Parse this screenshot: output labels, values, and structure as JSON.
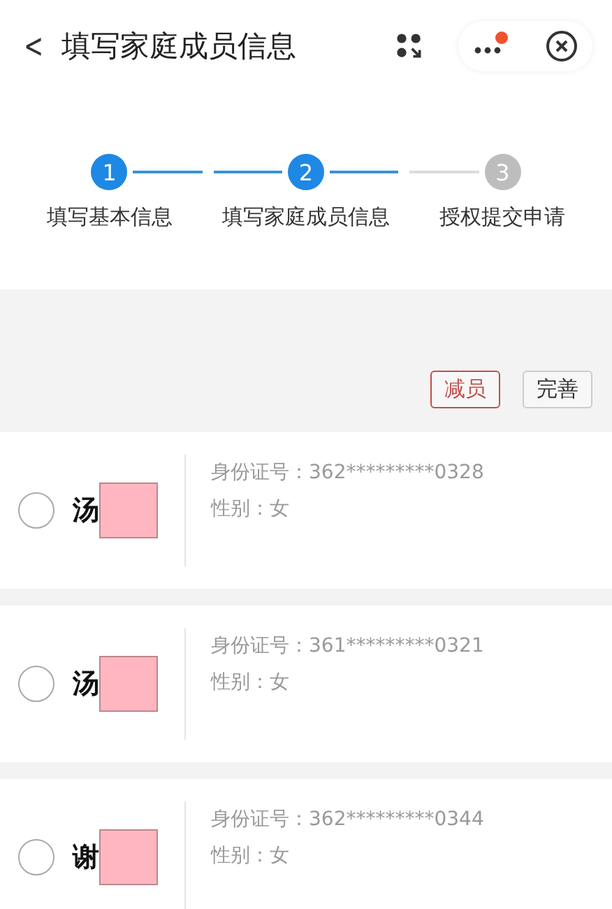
{
  "header": {
    "back": "<",
    "title": "填写家庭成员信息"
  },
  "steps": [
    {
      "number": "1",
      "label": "填写基本信息",
      "active": true
    },
    {
      "number": "2",
      "label": "填写家庭成员信息",
      "active": true
    },
    {
      "number": "3",
      "label": "授权提交申请",
      "active": false
    }
  ],
  "actions": [
    {
      "label": "减员",
      "kind": "danger"
    },
    {
      "label": "完善",
      "kind": "plain"
    }
  ],
  "members": [
    {
      "name": "汤",
      "selected": false,
      "id_label": "身份证号：",
      "id_number": "362*********0328",
      "gender_label": "性别：",
      "gender": "女"
    },
    {
      "name": "汤",
      "selected": false,
      "id_label": "身份证号：",
      "id_number": "361*********0321",
      "gender_label": "性别：",
      "gender": "女"
    },
    {
      "name": "谢",
      "selected": false,
      "id_label": "身份证号：",
      "id_number": "362*********0344",
      "gender_label": "性别：",
      "gender": "女"
    }
  ]
}
